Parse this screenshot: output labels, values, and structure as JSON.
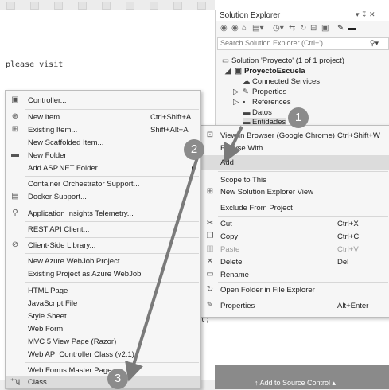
{
  "editor": {
    "text_visible": "please visit",
    "code_fragment": "t;"
  },
  "solution_explorer": {
    "title": "Solution Explorer",
    "window_controls": "▾ ↧ ✕",
    "search_placeholder": "Search Solution Explorer (Ctrl+')",
    "toolbar_icons": [
      "back-icon",
      "forward-icon",
      "home-icon",
      "switch-views-icon",
      "history-icon",
      "sync-icon",
      "refresh-icon",
      "collapse-icon",
      "show-files-icon",
      "properties-wrench-icon",
      "minimize-icon"
    ],
    "tree": [
      {
        "label": "Solution 'Proyecto' (1 of 1 project)",
        "icon": "solution-icon"
      },
      {
        "label": "ProyectoEscuela",
        "icon": "project-icon"
      },
      {
        "label": "Connected Services",
        "icon": "connected-services-icon"
      },
      {
        "label": "Properties",
        "icon": "wrench-icon"
      },
      {
        "label": "References",
        "icon": "references-icon"
      },
      {
        "label": "Datos",
        "icon": "folder-icon"
      },
      {
        "label": "Entidades",
        "icon": "folder-icon"
      }
    ]
  },
  "context_menu": {
    "items": [
      {
        "label": "View in Browser (Google Chrome)",
        "shortcut": "Ctrl+Shift+W",
        "icon": "browser-icon"
      },
      {
        "label": "Browse With...",
        "shortcut": "",
        "icon": ""
      },
      {
        "label": "Add",
        "shortcut": "",
        "icon": ""
      },
      {
        "label": "Scope to This",
        "shortcut": "",
        "icon": ""
      },
      {
        "label": "New Solution Explorer View",
        "shortcut": "",
        "icon": "new-view-icon"
      },
      {
        "label": "Exclude From Project",
        "shortcut": "",
        "icon": ""
      },
      {
        "label": "Cut",
        "shortcut": "Ctrl+X",
        "icon": "scissors-icon"
      },
      {
        "label": "Copy",
        "shortcut": "Ctrl+C",
        "icon": "copy-icon"
      },
      {
        "label": "Paste",
        "shortcut": "Ctrl+V",
        "icon": "paste-icon"
      },
      {
        "label": "Delete",
        "shortcut": "Del",
        "icon": "delete-x-icon"
      },
      {
        "label": "Rename",
        "shortcut": "",
        "icon": "rename-icon"
      },
      {
        "label": "Open Folder in File Explorer",
        "shortcut": "",
        "icon": "open-folder-icon"
      },
      {
        "label": "Properties",
        "shortcut": "Alt+Enter",
        "icon": "wrench-icon"
      }
    ]
  },
  "add_submenu": {
    "items": [
      {
        "label": "Controller...",
        "shortcut": "",
        "icon": "controller-icon"
      },
      {
        "label": "New Item...",
        "shortcut": "Ctrl+Shift+A",
        "icon": "new-item-icon"
      },
      {
        "label": "Existing Item...",
        "shortcut": "Shift+Alt+A",
        "icon": "existing-item-icon"
      },
      {
        "label": "New Scaffolded Item...",
        "shortcut": "",
        "icon": ""
      },
      {
        "label": "New Folder",
        "shortcut": "",
        "icon": "new-folder-icon"
      },
      {
        "label": "Add ASP.NET Folder",
        "shortcut": "",
        "icon": ""
      },
      {
        "label": "Container Orchestrator Support...",
        "shortcut": "",
        "icon": ""
      },
      {
        "label": "Docker Support...",
        "shortcut": "",
        "icon": "docker-icon"
      },
      {
        "label": "Application Insights Telemetry...",
        "shortcut": "",
        "icon": "insights-icon"
      },
      {
        "label": "REST API Client...",
        "shortcut": "",
        "icon": ""
      },
      {
        "label": "Client-Side Library...",
        "shortcut": "",
        "icon": "library-icon"
      },
      {
        "label": "New Azure WebJob Project",
        "shortcut": "",
        "icon": ""
      },
      {
        "label": "Existing Project as Azure WebJob",
        "shortcut": "",
        "icon": ""
      },
      {
        "label": "HTML Page",
        "shortcut": "",
        "icon": ""
      },
      {
        "label": "JavaScript File",
        "shortcut": "",
        "icon": ""
      },
      {
        "label": "Style Sheet",
        "shortcut": "",
        "icon": ""
      },
      {
        "label": "Web Form",
        "shortcut": "",
        "icon": ""
      },
      {
        "label": "MVC 5 View Page (Razor)",
        "shortcut": "",
        "icon": ""
      },
      {
        "label": "Web API Controller Class (v2.1)",
        "shortcut": "",
        "icon": ""
      },
      {
        "label": "Web Forms Master Page",
        "shortcut": "",
        "icon": ""
      },
      {
        "label": "Class...",
        "shortcut": "",
        "icon": "class-icon"
      }
    ]
  },
  "annotations": {
    "step1": "1",
    "step2": "2",
    "step3": "3",
    "arrow_color": "#7a7a7a",
    "badge_color": "#8b8b8b"
  },
  "status_bar": {
    "source_control": "↑  Add to Source Control  ▴"
  }
}
